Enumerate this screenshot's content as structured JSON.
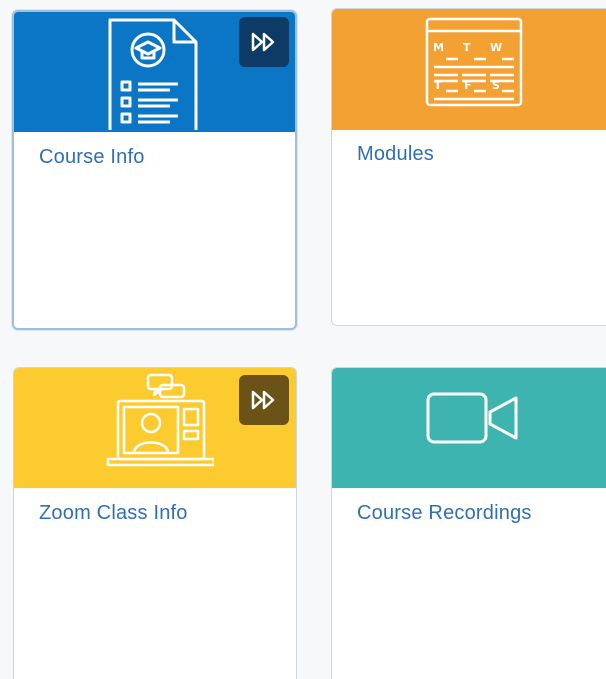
{
  "cards": [
    {
      "title": "Course Info",
      "header_color": "#0a76c5",
      "icon": "course-document-graduation-cap-icon",
      "fast_forward": true,
      "fast_forward_color": "#0d3b66",
      "selected": true
    },
    {
      "title": "Modules",
      "header_color": "#f4a134",
      "icon": "weekly-calendar-schedule-icon",
      "fast_forward": false,
      "selected": false,
      "calendar_letters": [
        "M",
        "T",
        "W",
        "T",
        "F",
        "S"
      ]
    },
    {
      "title": "Zoom Class Info",
      "header_color": "#fccb2f",
      "icon": "laptop-video-call-icon",
      "fast_forward": true,
      "fast_forward_color": "#6b5317",
      "selected": false
    },
    {
      "title": "Course Recordings",
      "header_color": "#3db4b0",
      "icon": "video-camera-icon",
      "fast_forward": false,
      "selected": false
    }
  ],
  "icon_stroke_color": "#ffffff",
  "fast_forward_icon": "fast-forward-icon",
  "link_color": "#2f6fb3"
}
